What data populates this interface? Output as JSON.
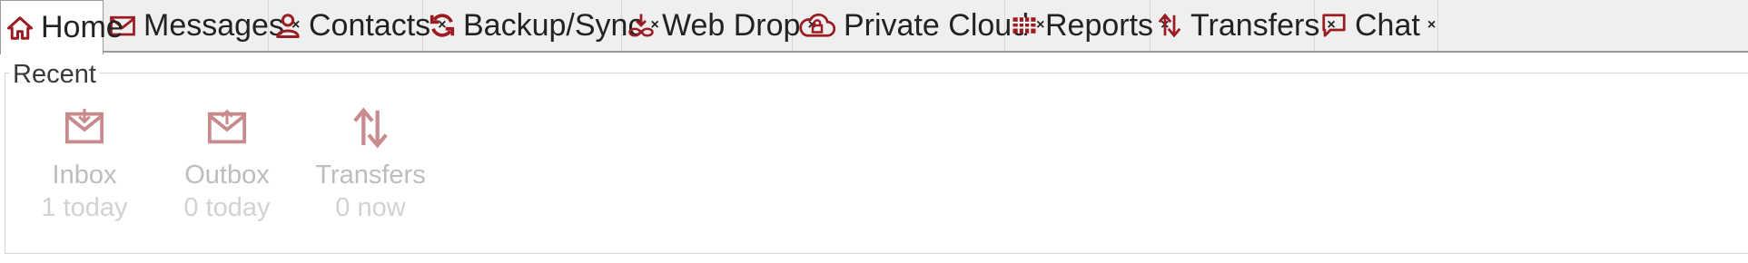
{
  "tabs": [
    {
      "label": "Home",
      "icon": "home-icon",
      "active": true,
      "closable": false
    },
    {
      "label": "Messages",
      "icon": "envelope-icon",
      "closable": true
    },
    {
      "label": "Contacts",
      "icon": "person-icon",
      "closable": true
    },
    {
      "label": "Backup/Sync",
      "icon": "sync-icon",
      "closable": true
    },
    {
      "label": "Web Drop",
      "icon": "web-drop-icon",
      "closable": true
    },
    {
      "label": "Private Cloud",
      "icon": "cloud-lock-icon",
      "closable": true
    },
    {
      "label": "Reports",
      "icon": "table-icon",
      "closable": true
    },
    {
      "label": "Transfers",
      "icon": "transfer-arrows-icon",
      "closable": true
    },
    {
      "label": "Chat",
      "icon": "chat-bubble-icon",
      "closable": true
    }
  ],
  "close_glyph": "×",
  "recent": {
    "title": "Recent",
    "items": [
      {
        "label": "Inbox",
        "sub": "1 today",
        "icon": "inbox-icon"
      },
      {
        "label": "Outbox",
        "sub": "0 today",
        "icon": "outbox-icon"
      },
      {
        "label": "Transfers",
        "sub": "0 now",
        "icon": "transfers-icon"
      }
    ]
  },
  "colors": {
    "accent": "#9b1c22",
    "faded_icon": "#c98a8d",
    "tab_bar": "#efefef"
  }
}
